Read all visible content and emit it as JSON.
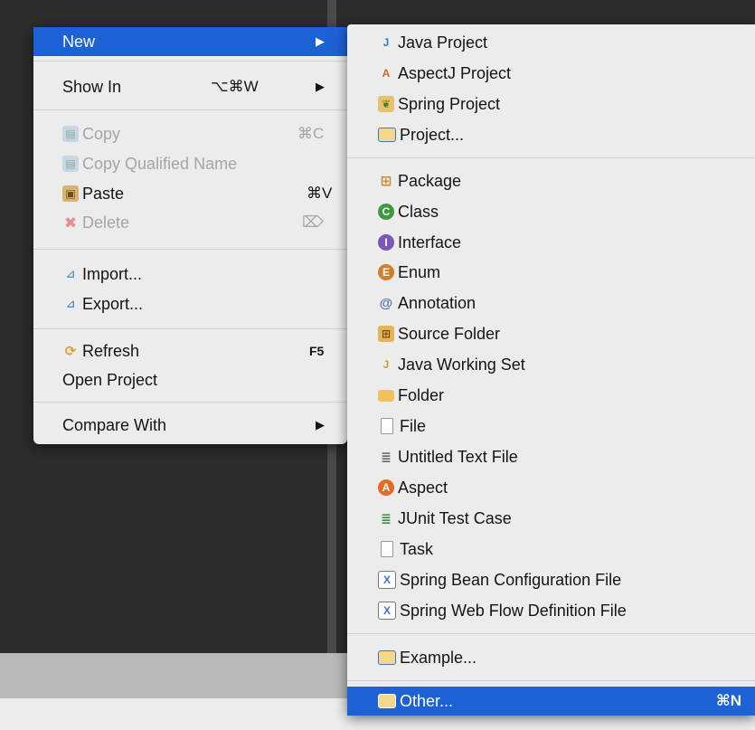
{
  "context_menu": {
    "items": [
      {
        "label": "New",
        "submenu_arrow": "▶"
      },
      {
        "label": "Show In",
        "shortcut": "⌥⌘W",
        "submenu_arrow": "▶"
      },
      {
        "label": "Copy",
        "shortcut": "⌘C",
        "icon": "copy-icon"
      },
      {
        "label": "Copy Qualified Name",
        "icon": "copy-qualified-name-icon"
      },
      {
        "label": "Paste",
        "shortcut": "⌘V",
        "icon": "paste-icon"
      },
      {
        "label": "Delete",
        "shortcut": "⌦",
        "icon": "delete-icon"
      },
      {
        "label": "Import...",
        "icon": "import-icon"
      },
      {
        "label": "Export...",
        "icon": "export-icon"
      },
      {
        "label": "Refresh",
        "shortcut": "F5",
        "icon": "refresh-icon"
      },
      {
        "label": "Open Project"
      },
      {
        "label": "Compare With",
        "submenu_arrow": "▶"
      }
    ]
  },
  "new_submenu": {
    "items": [
      {
        "label": "Java Project",
        "icon": "java-project-icon"
      },
      {
        "label": "AspectJ Project",
        "icon": "aspectj-project-icon"
      },
      {
        "label": "Spring Project",
        "icon": "spring-project-icon"
      },
      {
        "label": "Project...",
        "icon": "project-icon"
      },
      {
        "label": "Package",
        "icon": "package-icon"
      },
      {
        "label": "Class",
        "icon": "class-icon"
      },
      {
        "label": "Interface",
        "icon": "interface-icon"
      },
      {
        "label": "Enum",
        "icon": "enum-icon"
      },
      {
        "label": "Annotation",
        "icon": "annotation-icon"
      },
      {
        "label": "Source Folder",
        "icon": "source-folder-icon"
      },
      {
        "label": "Java Working Set",
        "icon": "java-working-set-icon"
      },
      {
        "label": "Folder",
        "icon": "folder-icon"
      },
      {
        "label": "File",
        "icon": "file-icon"
      },
      {
        "label": "Untitled Text File",
        "icon": "untitled-text-file-icon"
      },
      {
        "label": "Aspect",
        "icon": "aspect-icon"
      },
      {
        "label": "JUnit Test Case",
        "icon": "junit-test-case-icon"
      },
      {
        "label": "Task",
        "icon": "task-icon"
      },
      {
        "label": "Spring Bean Configuration File",
        "icon": "spring-bean-config-file-icon"
      },
      {
        "label": "Spring Web Flow Definition File",
        "icon": "spring-web-flow-file-icon"
      },
      {
        "label": "Example...",
        "icon": "example-icon"
      },
      {
        "label": "Other...",
        "shortcut": "⌘N",
        "icon": "other-icon"
      }
    ]
  },
  "colors": {
    "highlight": "#1c61d6",
    "menu_bg": "#ececec",
    "disabled_text": "#a5a5a5"
  }
}
